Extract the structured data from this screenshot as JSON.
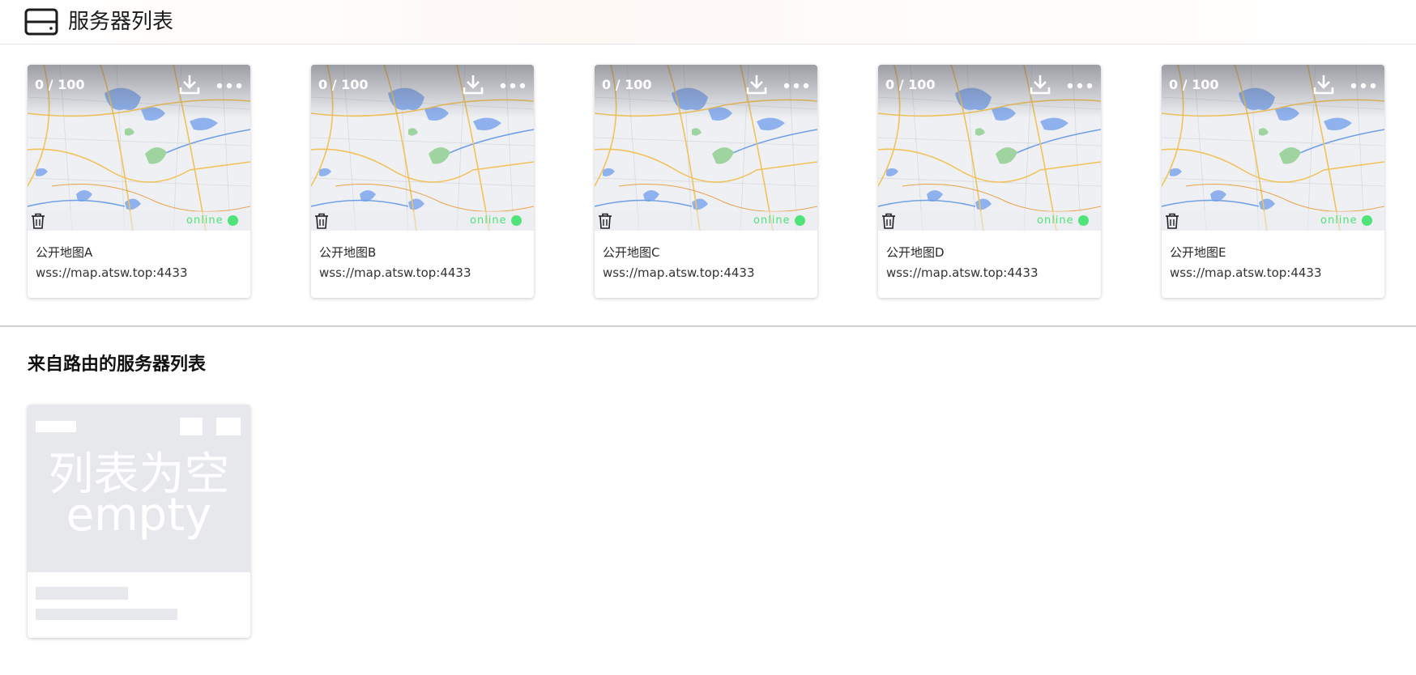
{
  "header": {
    "title": "服务器列表",
    "icon": "server-icon"
  },
  "servers": [
    {
      "count": "0 / 100",
      "status": "online",
      "name": "公开地图A",
      "url": "wss://map.atsw.top:4433"
    },
    {
      "count": "0 / 100",
      "status": "online",
      "name": "公开地图B",
      "url": "wss://map.atsw.top:4433"
    },
    {
      "count": "0 / 100",
      "status": "online",
      "name": "公开地图C",
      "url": "wss://map.atsw.top:4433"
    },
    {
      "count": "0 / 100",
      "status": "online",
      "name": "公开地图D",
      "url": "wss://map.atsw.top:4433"
    },
    {
      "count": "0 / 100",
      "status": "online",
      "name": "公开地图E",
      "url": "wss://map.atsw.top:4433"
    }
  ],
  "route_section": {
    "title": "来自路由的服务器列表",
    "empty_line1": "列表为空",
    "empty_line2": "empty"
  },
  "colors": {
    "online": "#4fe37a",
    "divider": "#cfcfcf"
  }
}
